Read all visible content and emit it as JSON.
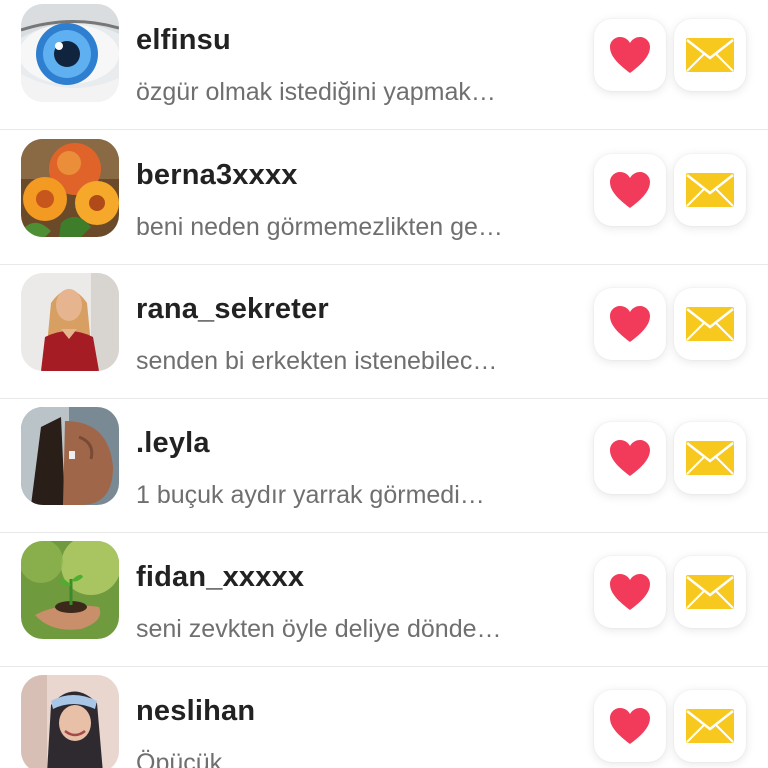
{
  "colors": {
    "heart": "#f23b5a",
    "envelope": "#f7c81e",
    "name_text": "#222222",
    "message_text": "#6f6f6f"
  },
  "icons": {
    "like": "heart-icon",
    "message": "envelope-icon"
  },
  "contacts": [
    {
      "username": "elfinsu",
      "message": "özgür olmak istediğini yapmak…",
      "avatar": "eye-photo"
    },
    {
      "username": "berna3xxxx",
      "message": "beni neden görmemezlikten ge…",
      "avatar": "peaches-photo"
    },
    {
      "username": "rana_sekreter",
      "message": "senden bi erkekten istenebilec…",
      "avatar": "woman-red-dress-photo"
    },
    {
      "username": ".leyla",
      "message": "1 buçuk aydır yarrak görmedi…",
      "avatar": "woman-profile-photo"
    },
    {
      "username": "fidan_xxxxx",
      "message": "seni zevkten öyle deliye dönde…",
      "avatar": "sapling-hands-photo"
    },
    {
      "username": "neslihan",
      "message": "Öpücük",
      "avatar": "woman-hijab-photo"
    }
  ]
}
